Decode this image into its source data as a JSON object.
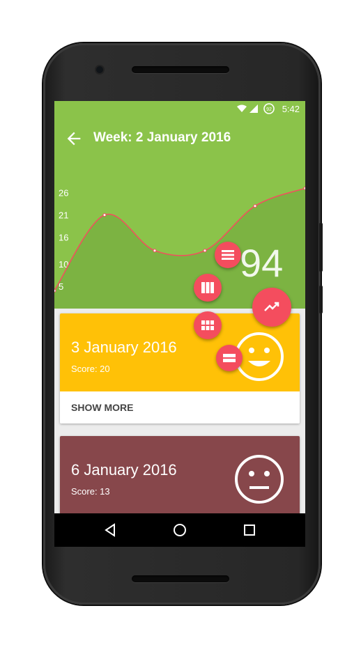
{
  "status_bar": {
    "time": "5:42",
    "battery_level": "92"
  },
  "toolbar": {
    "title": "Week: 2 January 2016"
  },
  "chart_data": {
    "type": "line",
    "y_ticks": [
      "26",
      "21",
      "16",
      "10",
      "5"
    ],
    "x": [
      0,
      1,
      2,
      3,
      4,
      5
    ],
    "values": [
      4,
      21,
      13,
      13,
      23,
      27
    ],
    "ylim": [
      0,
      30
    ],
    "line_color": "#f44d5e",
    "fill_color": "#7cb342"
  },
  "summary": {
    "total_score": "94"
  },
  "cards": [
    {
      "date": "3 January 2016",
      "score_text": "Score: 20",
      "mood": "happy",
      "color": "#ffc107",
      "action": "SHOW MORE"
    },
    {
      "date": "6 January 2016",
      "score_text": "Score: 13",
      "mood": "neutral",
      "color": "#87474b"
    }
  ],
  "fab_menu": {
    "main_icon": "trending-up-icon",
    "items": [
      "view-list-icon",
      "view-column-icon",
      "view-module-icon",
      "view-stream-icon"
    ]
  },
  "colors": {
    "header": "#8bc34a",
    "fab": "#f44d5e"
  }
}
